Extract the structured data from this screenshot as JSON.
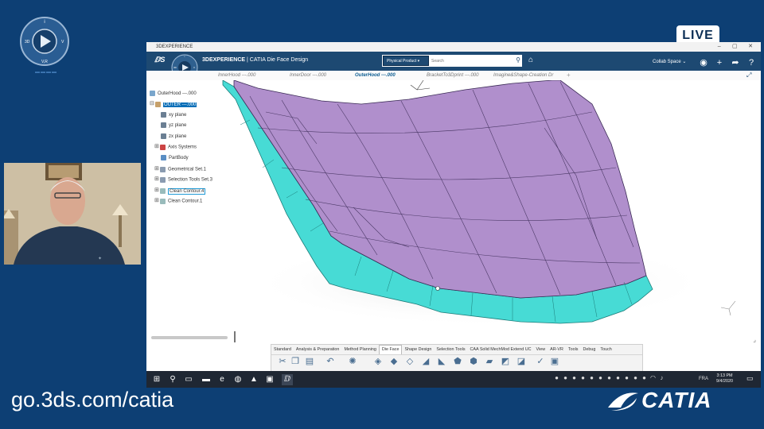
{
  "overlay": {
    "live_badge": "LIVE",
    "footer_url": "go.3ds.com/catia",
    "footer_brand": "CATIA",
    "compass_letters": {
      "top": "i",
      "left": "3D",
      "right": "V",
      "bottom": "V,R"
    }
  },
  "window": {
    "title": "3DEXPERIENCE",
    "controls": [
      "–",
      "▢",
      "✕"
    ]
  },
  "appbar": {
    "brand_bold": "3DEXPERIENCE",
    "brand_rest": " | CATIA Die Face Design",
    "search_scope": "Physical Product ▾",
    "search_placeholder": "Search",
    "collab_space": "Collab Space ⌄",
    "compass_letters": {
      "top": "i",
      "left": "3D",
      "right": "V",
      "bottom": "V,R"
    }
  },
  "tabs": [
    {
      "label": "InnerHood ---.000",
      "active": false
    },
    {
      "label": "InnerDoor ---.000",
      "active": false
    },
    {
      "label": "OuterHood ---.000",
      "active": true
    },
    {
      "label": "BracketTo3Dprint ---.000",
      "active": false
    },
    {
      "label": "Imagine&Shape-Creation Dr",
      "active": false
    }
  ],
  "tree": {
    "root": "OuterHood ---.000",
    "part": "OUTER ---.000",
    "children": [
      "xy plane",
      "yz plane",
      "zx plane",
      "Axis Systems",
      "PartBody",
      "Geometrical Set.1",
      "Selection Tools Set.3",
      "Clean Contour.4",
      "Clean Contour.1"
    ]
  },
  "action_bar": {
    "sections": [
      "Standard",
      "Analysis & Preparation",
      "Method Planning",
      "Die Face",
      "Shape Design",
      "Selection Tools",
      "CAA Solid MechMod Extend UC",
      "View",
      "AR-VR",
      "Tools",
      "Debug",
      "Touch"
    ],
    "active_section": "Die Face",
    "tool_icons": [
      "scissors-icon",
      "copy-icon",
      "paste-icon",
      "undo-icon",
      "compass-icon",
      "surface-icon",
      "addendum-icon",
      "binder-icon",
      "flange-icon",
      "fillet-icon",
      "blend-icon",
      "trim-icon",
      "extend-icon",
      "offset-icon",
      "project-icon",
      "check-icon"
    ]
  },
  "taskbar": {
    "lang": "FRA",
    "time": "3:13 PM",
    "date": "9/4/2020"
  },
  "colors": {
    "hood_surface": "#b08fcc",
    "hood_flange": "#47dbd5",
    "app_bar": "#1d4972",
    "background": "#0d3f74"
  }
}
